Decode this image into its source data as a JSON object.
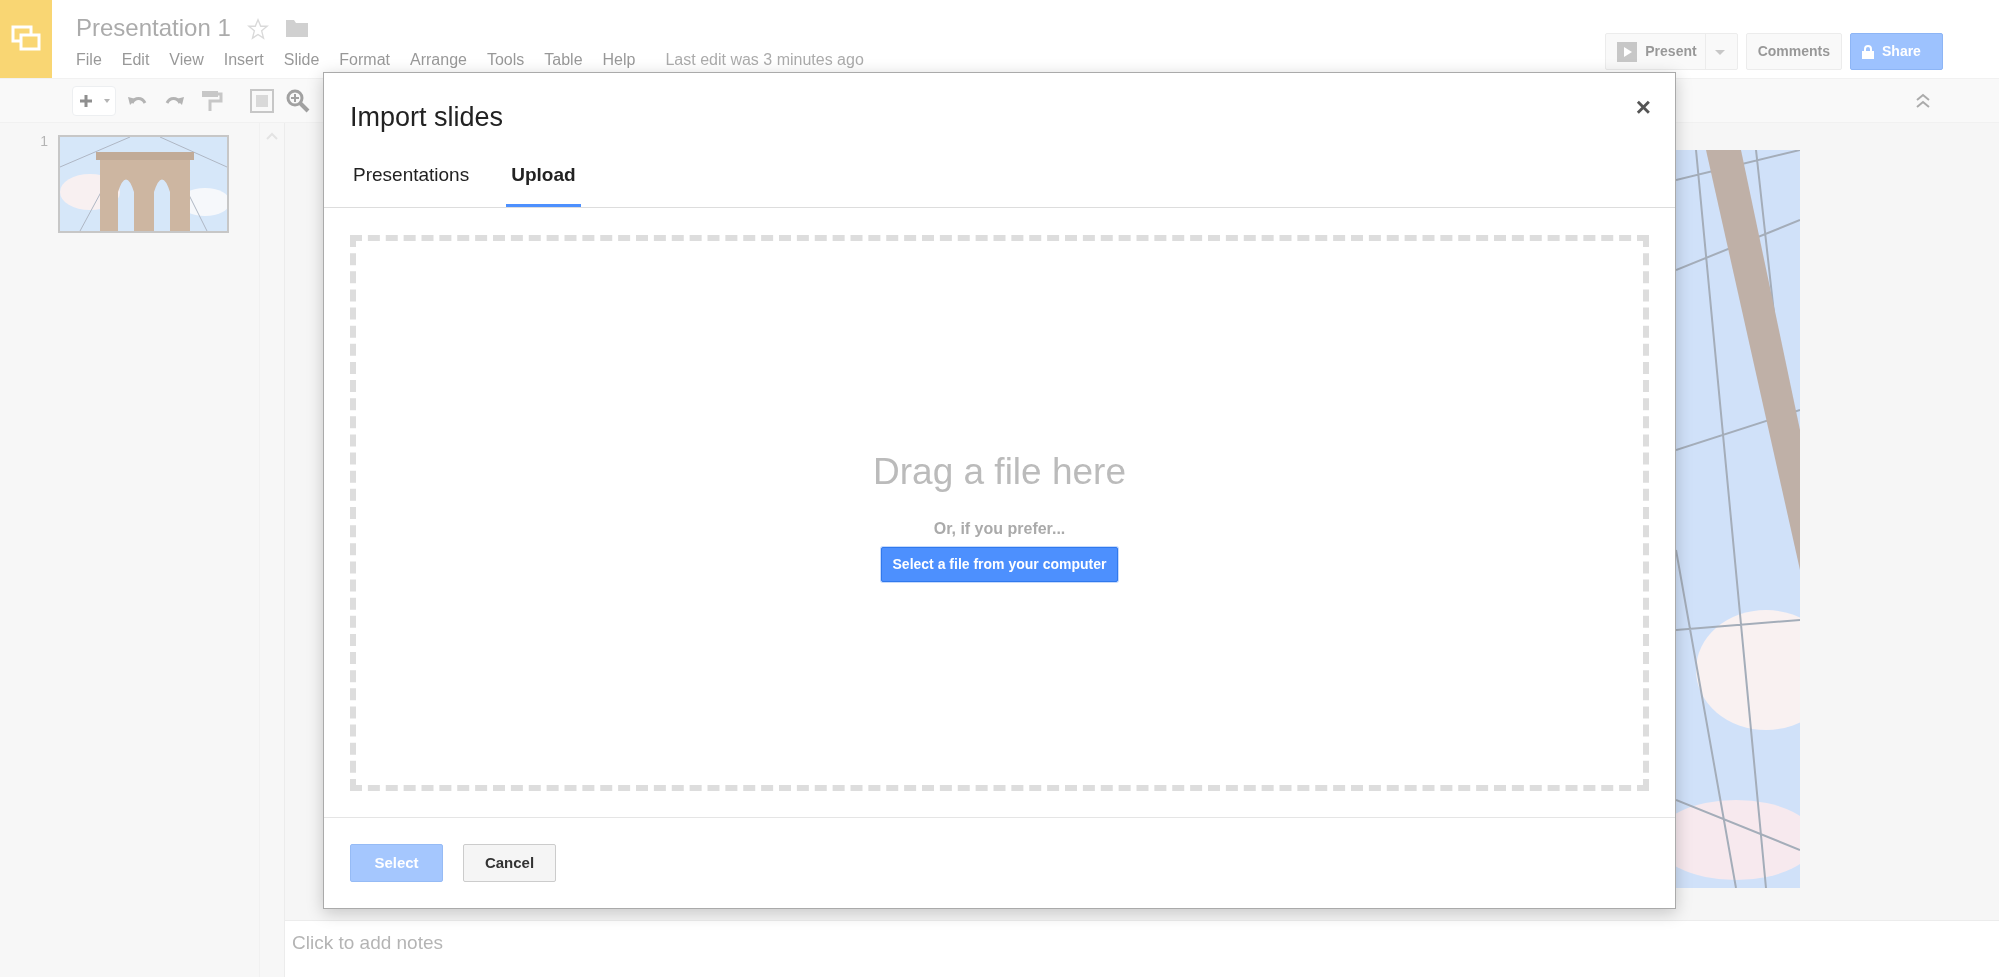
{
  "app": {
    "title": "Presentation 1",
    "starred": false,
    "last_edit": "Last edit was 3 minutes ago",
    "menu": [
      "File",
      "Edit",
      "View",
      "Insert",
      "Slide",
      "Format",
      "Arrange",
      "Tools",
      "Table",
      "Help"
    ]
  },
  "header_buttons": [
    {
      "label": "Present",
      "kind": "split"
    },
    {
      "label": "Comments",
      "kind": "plain"
    },
    {
      "label": "Share",
      "kind": "share"
    }
  ],
  "slides": [
    {
      "number": "1"
    }
  ],
  "notes": {
    "placeholder": "Click to add notes"
  },
  "dialog": {
    "title": "Import slides",
    "close": "×",
    "tabs": [
      {
        "label": "Presentations",
        "selected": false
      },
      {
        "label": "Upload",
        "selected": true
      }
    ],
    "drop_title": "Drag a file here",
    "drop_hint": "Or, if you prefer...",
    "upload_button": "Select a file from your computer",
    "buttons": [
      {
        "label": "Select",
        "kind": "primary",
        "disabled": true
      },
      {
        "label": "Cancel",
        "kind": "secondary",
        "disabled": false
      }
    ]
  }
}
